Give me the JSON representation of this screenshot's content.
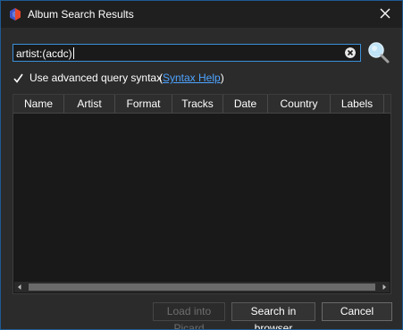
{
  "window": {
    "title": "Album Search Results",
    "app_icon": "picard-logo-icon",
    "close_icon": "close-icon"
  },
  "search": {
    "query": "artist:(acdc)",
    "clear_icon": "clear-input-icon",
    "search_icon": "magnifier-search-icon"
  },
  "options": {
    "advanced_syntax_label": "Use advanced query syntax",
    "advanced_syntax_checked": true,
    "syntax_help_open": "(",
    "syntax_help_link": "Syntax Help",
    "syntax_help_close": ")"
  },
  "table": {
    "columns": [
      "Name",
      "Artist",
      "Format",
      "Tracks",
      "Date",
      "Country",
      "Labels"
    ],
    "rows": []
  },
  "buttons": {
    "load": "Load into Picard",
    "browser": "Search in browser",
    "cancel": "Cancel"
  },
  "colors": {
    "accent": "#3b8fd8",
    "link": "#4da3ff",
    "window_bg": "#2b2b2b",
    "table_bg": "#191919"
  }
}
